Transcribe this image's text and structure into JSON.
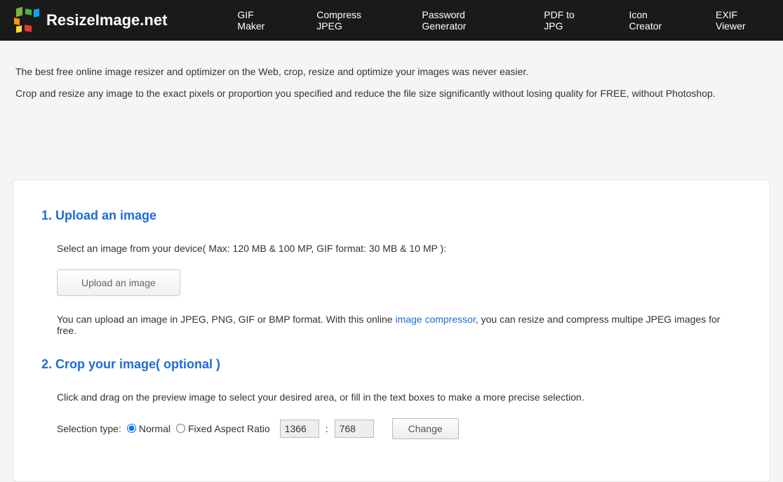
{
  "header": {
    "brand": "ResizeImage.net",
    "nav": [
      "GIF Maker",
      "Compress JPEG",
      "Password Generator",
      "PDF to JPG",
      "Icon Creator",
      "EXIF Viewer"
    ]
  },
  "intro": {
    "line1": "The best free online image resizer and optimizer on the Web, crop, resize and optimize your images was never easier.",
    "line2": "Crop and resize any image to the exact pixels or proportion you specified and reduce the file size significantly without losing quality for FREE, without Photoshop."
  },
  "sections": {
    "upload": {
      "title": "1. Upload an image",
      "instruction": "Select an image from your device( Max: 120 MB & 100 MP, GIF format: 30 MB & 10 MP ):",
      "button": "Upload an image",
      "note_pre": "You can upload an image in JPEG, PNG, GIF or BMP format. With this online ",
      "note_link": "image compressor",
      "note_post": ", you can resize and compress multipe JPEG images for free."
    },
    "crop": {
      "title": "2. Crop your image( optional )",
      "instruction": "Click and drag on the preview image to select your desired area, or fill in the text boxes to make a more precise selection.",
      "selection_label": "Selection type:",
      "radio_normal": "Normal",
      "radio_fixed": "Fixed Aspect Ratio",
      "width": "1366",
      "height": "768",
      "change_btn": "Change"
    }
  }
}
